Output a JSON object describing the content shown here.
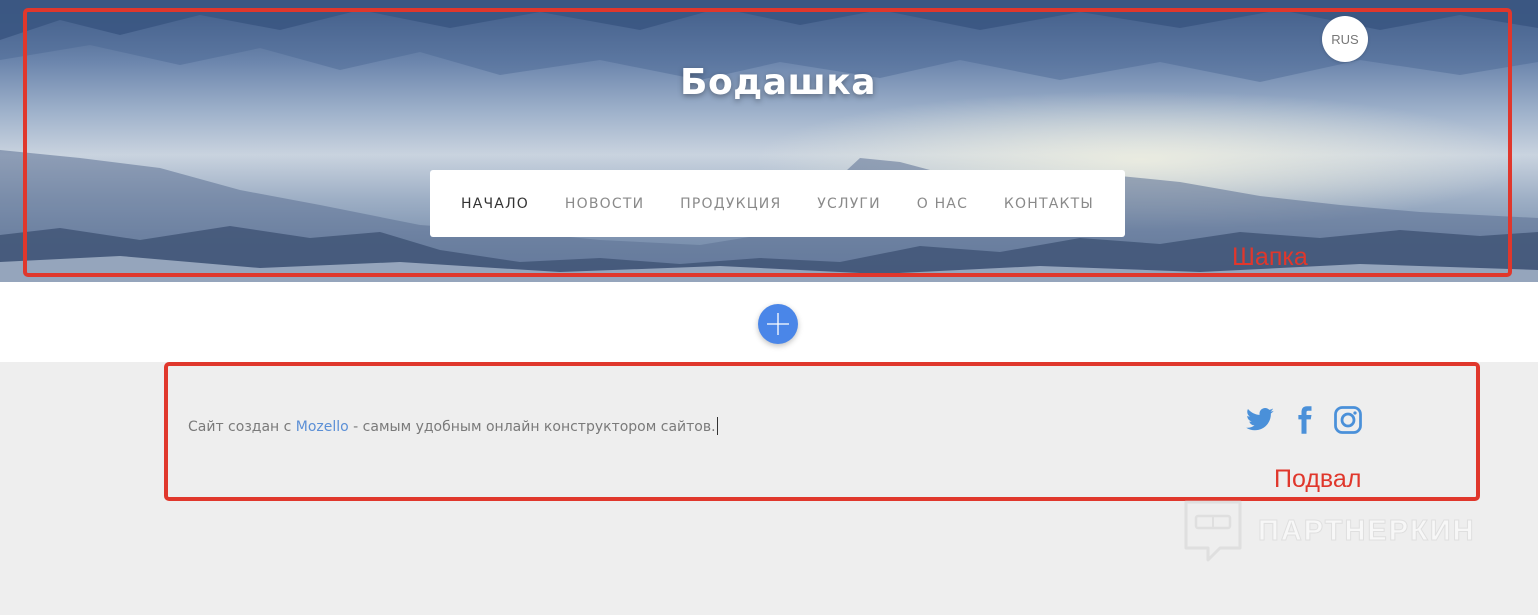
{
  "header": {
    "site_title": "Бодашка",
    "lang_label": "RUS",
    "nav": [
      {
        "label": "НАЧАЛО",
        "active": true
      },
      {
        "label": "НОВОСТИ",
        "active": false
      },
      {
        "label": "ПРОДУКЦИЯ",
        "active": false
      },
      {
        "label": "УСЛУГИ",
        "active": false
      },
      {
        "label": "О НАС",
        "active": false
      },
      {
        "label": "КОНТАКТЫ",
        "active": false
      }
    ]
  },
  "annotations": {
    "header_label": "Шапка",
    "footer_label": "Подвал",
    "color": "#e0372c"
  },
  "add_block": {
    "icon": "plus-icon",
    "color": "#4a86e8"
  },
  "footer": {
    "text_before": "Сайт создан с ",
    "link_text": "Mozello",
    "text_after": " - самым удобным онлайн конструктором сайтов.",
    "social": [
      "twitter-icon",
      "facebook-icon",
      "instagram-icon"
    ],
    "social_color": "#4a90d9"
  },
  "watermark": {
    "text": "ПАРТНЕРКИН"
  }
}
